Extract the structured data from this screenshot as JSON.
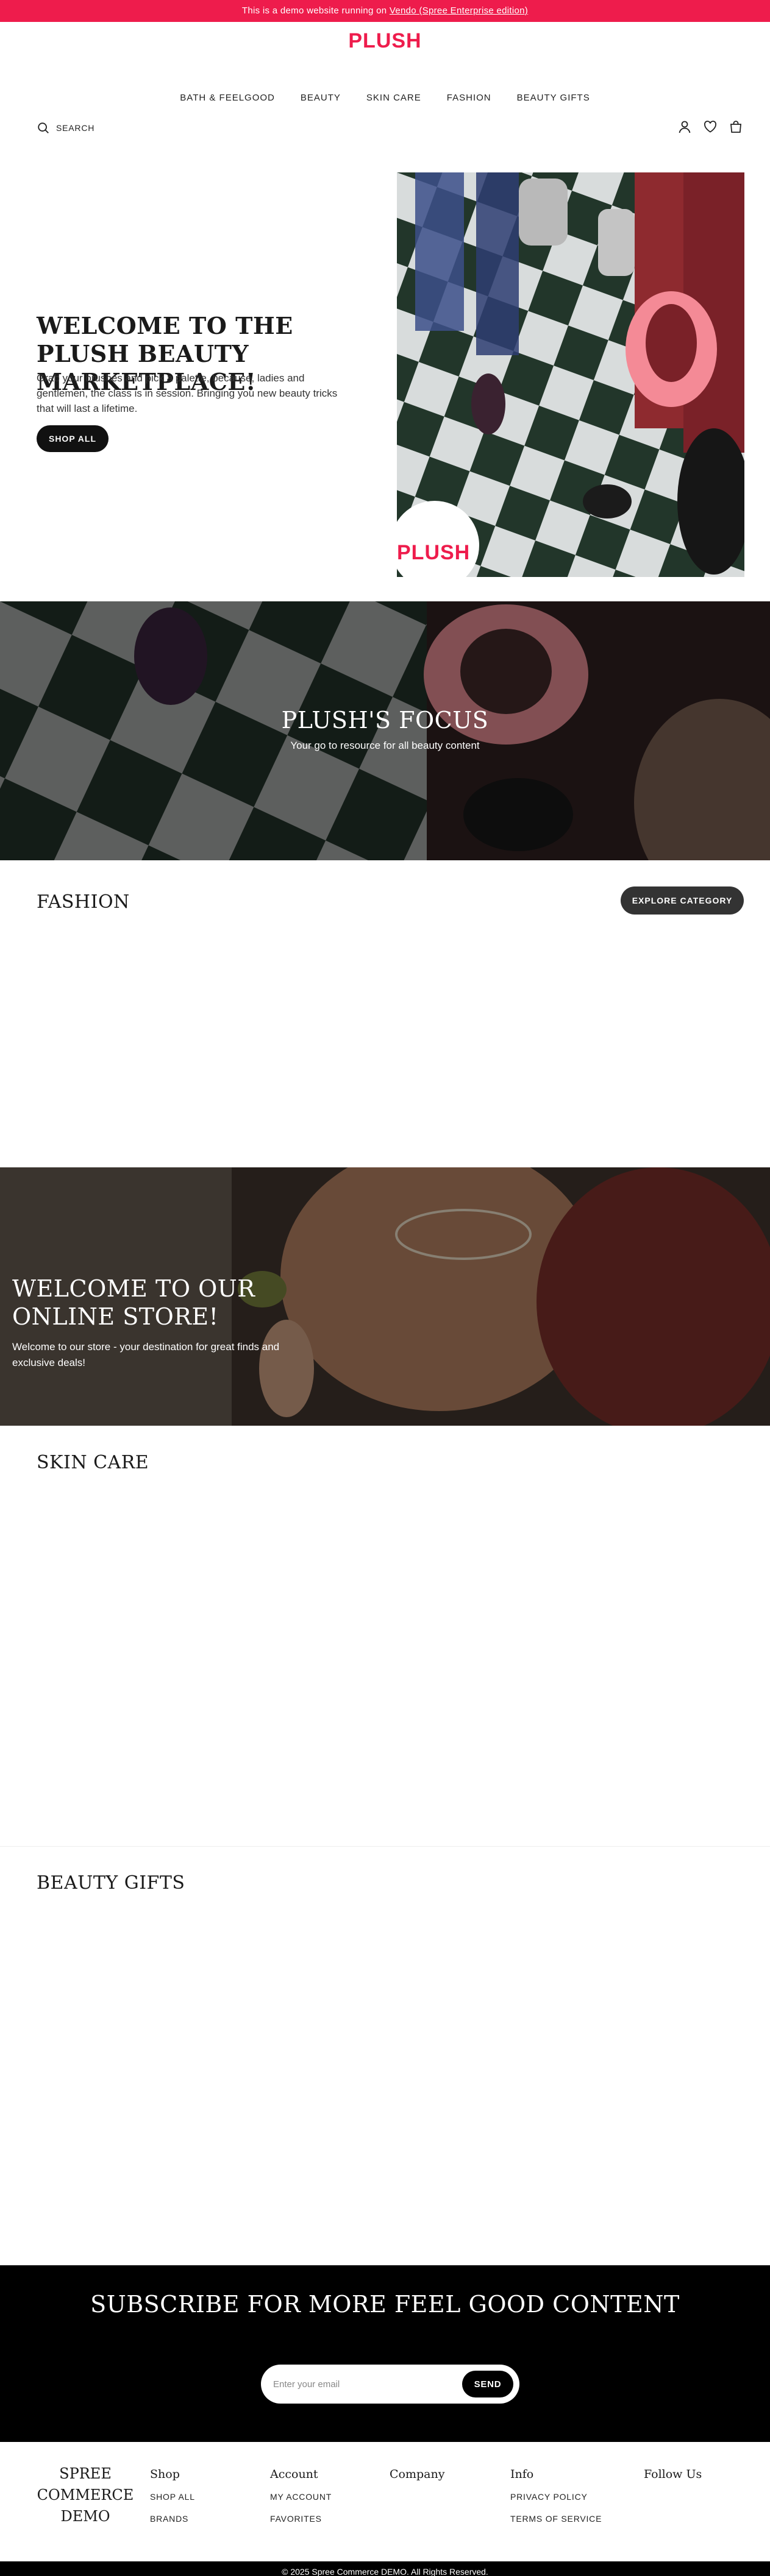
{
  "announcement": {
    "prefix": "This is a demo website running on ",
    "link_text": "Vendo (Spree Enterprise edition)"
  },
  "header": {
    "logo": "PLUSH",
    "nav": [
      "BATH & FEELGOOD",
      "BEAUTY",
      "SKIN CARE",
      "FASHION",
      "BEAUTY GIFTS"
    ],
    "search_label": "SEARCH",
    "icons": [
      "search-icon",
      "account-icon",
      "heart-icon",
      "bag-icon"
    ]
  },
  "hero": {
    "title": "WELCOME TO THE PLUSH BEAUTY MARKETPLACE!",
    "description": "Grab your brushes and pick a palette, because, ladies and gentlemen, the class is in session. Bringing you new beauty tricks that will last a lifetime.",
    "cta": "SHOP ALL",
    "badge_logo": "PLUSH"
  },
  "focus_banner": {
    "title": "PLUSH'S FOCUS",
    "subtitle": "Your go to resource for all beauty content"
  },
  "fashion": {
    "title": "FASHION",
    "cta": "EXPLORE CATEGORY"
  },
  "store_banner": {
    "title": "WELCOME TO OUR ONLINE STORE!",
    "description": "Welcome to our store - your destination for great finds and exclusive deals!"
  },
  "skin_care": {
    "title": "SKIN CARE"
  },
  "beauty_gifts": {
    "title": "BEAUTY GIFTS"
  },
  "subscribe": {
    "title": "SUBSCRIBE FOR MORE FEEL GOOD CONTENT",
    "placeholder": "Enter your email",
    "button": "SEND"
  },
  "footer": {
    "brand": "SPREE COMMERCE DEMO",
    "columns": [
      {
        "title": "Shop",
        "links": [
          "SHOP ALL",
          "BRANDS"
        ]
      },
      {
        "title": "Account",
        "links": [
          "MY ACCOUNT",
          "FAVORITES"
        ]
      },
      {
        "title": "Company",
        "links": []
      },
      {
        "title": "Info",
        "links": [
          "PRIVACY POLICY",
          "TERMS OF SERVICE"
        ]
      },
      {
        "title": "Follow Us",
        "links": []
      }
    ],
    "copyright": "© 2025 Spree Commerce DEMO. All Rights Reserved."
  },
  "colors": {
    "brand": "#ee1c4c",
    "dark": "#000000",
    "tile_green": "#24382c",
    "bag_pink": "#f48a96"
  }
}
